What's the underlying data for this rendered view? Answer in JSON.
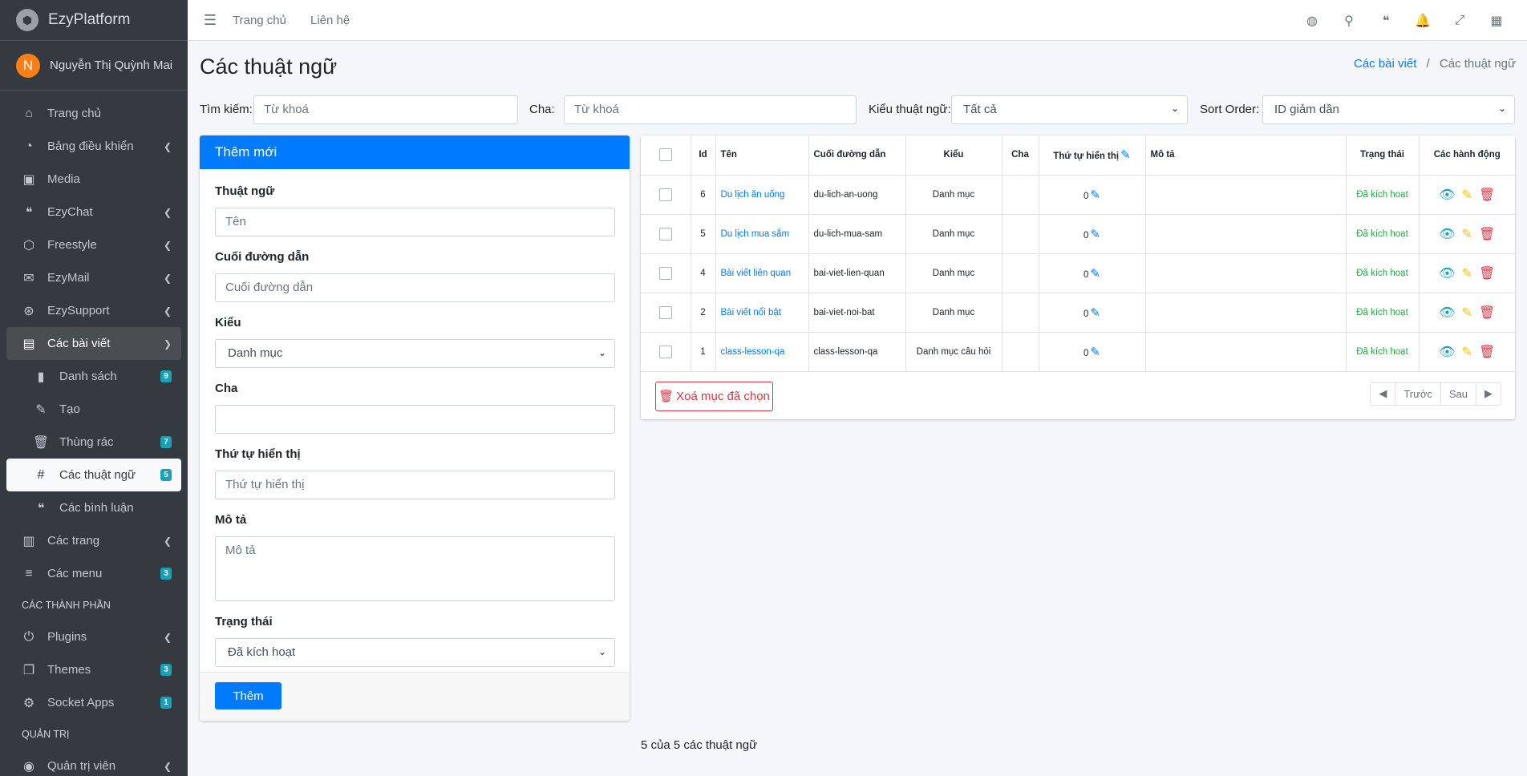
{
  "brand": {
    "name": "EzyPlatform"
  },
  "user": {
    "initial": "N",
    "name": "Nguyễn Thị Quỳnh Mai"
  },
  "sidebar": {
    "items": [
      {
        "label": "Trang chủ"
      },
      {
        "label": "Bảng điều khiển"
      },
      {
        "label": "Media"
      },
      {
        "label": "EzyChat"
      },
      {
        "label": "Freestyle"
      },
      {
        "label": "EzyMail"
      },
      {
        "label": "EzySupport"
      },
      {
        "label": "Các bài viết"
      }
    ],
    "sub_items": [
      {
        "label": "Danh sách",
        "badge": "9"
      },
      {
        "label": "Tạo"
      },
      {
        "label": "Thùng rác",
        "badge": "7"
      },
      {
        "label": "Các thuật ngữ",
        "badge": "5"
      },
      {
        "label": "Các bình luận"
      }
    ],
    "items2": [
      {
        "label": "Các trang"
      },
      {
        "label": "Các menu",
        "badge": "3"
      }
    ],
    "header_components": "CÁC THÀNH PHẦN",
    "items3": [
      {
        "label": "Plugins"
      },
      {
        "label": "Themes",
        "badge": "3"
      },
      {
        "label": "Socket Apps",
        "badge": "1"
      }
    ],
    "header_admin": "QUẢN TRỊ",
    "items4": [
      {
        "label": "Quản trị viên"
      }
    ]
  },
  "topbar": {
    "links": [
      "Trang chủ",
      "Liên hệ"
    ]
  },
  "page": {
    "title": "Các thuật ngữ"
  },
  "breadcrumb": {
    "parent": "Các bài viết",
    "current": "Các thuật ngữ"
  },
  "filters": {
    "search_label": "Tìm kiếm:",
    "search_placeholder": "Từ khoá",
    "parent_label": "Cha:",
    "parent_placeholder": "Từ khoá",
    "type_label": "Kiểu thuật ngữ:",
    "type_value": "Tất cả",
    "sort_label": "Sort Order:",
    "sort_value": "ID giảm dần"
  },
  "form": {
    "header": "Thêm mới",
    "term_label": "Thuật ngữ",
    "term_placeholder": "Tên",
    "slug_label": "Cuối đường dẫn",
    "slug_placeholder": "Cuối đường dẫn",
    "type_label": "Kiểu",
    "type_value": "Danh mục",
    "parent_label": "Cha",
    "order_label": "Thứ tự hiển thị",
    "order_placeholder": "Thứ tự hiển thị",
    "desc_label": "Mô tả",
    "desc_placeholder": "Mô tả",
    "status_label": "Trạng thái",
    "status_value": "Đã kích hoạt",
    "submit": "Thêm"
  },
  "table": {
    "headers": {
      "id": "Id",
      "name": "Tên",
      "slug": "Cuối đường dẫn",
      "type": "Kiểu",
      "parent": "Cha",
      "order": "Thứ tự hiển thị",
      "desc": "Mô tả",
      "status": "Trạng thái",
      "actions": "Các hành động"
    },
    "rows": [
      {
        "id": "6",
        "name": "Du lịch ăn uống",
        "slug": "du-lich-an-uong",
        "type": "Danh mục",
        "parent": "",
        "order": "0",
        "desc": "",
        "status": "Đã kích hoạt"
      },
      {
        "id": "5",
        "name": "Du lịch mua sắm",
        "slug": "du-lich-mua-sam",
        "type": "Danh mục",
        "parent": "",
        "order": "0",
        "desc": "",
        "status": "Đã kích hoạt"
      },
      {
        "id": "4",
        "name": "Bài viết liên quan",
        "slug": "bai-viet-lien-quan",
        "type": "Danh mục",
        "parent": "",
        "order": "0",
        "desc": "",
        "status": "Đã kích hoạt"
      },
      {
        "id": "2",
        "name": "Bài viết nổi bật",
        "slug": "bai-viet-noi-bat",
        "type": "Danh mục",
        "parent": "",
        "order": "0",
        "desc": "",
        "status": "Đã kích hoạt"
      },
      {
        "id": "1",
        "name": "class-lesson-qa",
        "slug": "class-lesson-qa",
        "type": "Danh mục câu hỏi",
        "parent": "",
        "order": "0",
        "desc": "",
        "status": "Đã kích hoạt"
      }
    ],
    "delete_selected": "Xoá mục đã chọn",
    "prev": "Trước",
    "next": "Sau"
  },
  "summary": "5 của 5 các thuật ngữ"
}
